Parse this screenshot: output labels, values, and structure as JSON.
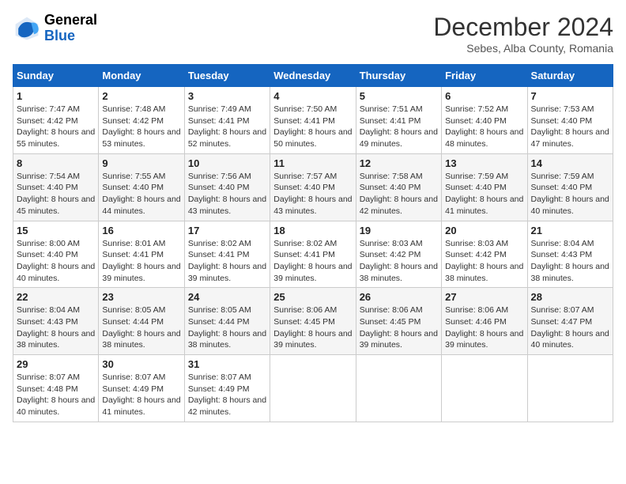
{
  "header": {
    "logo_general": "General",
    "logo_blue": "Blue",
    "title": "December 2024",
    "location": "Sebes, Alba County, Romania"
  },
  "calendar": {
    "days_of_week": [
      "Sunday",
      "Monday",
      "Tuesday",
      "Wednesday",
      "Thursday",
      "Friday",
      "Saturday"
    ],
    "weeks": [
      [
        null,
        null,
        null,
        null,
        null,
        null,
        null
      ]
    ],
    "cells": [
      {
        "day": null,
        "sunrise": null,
        "sunset": null,
        "daylight": null
      },
      {
        "day": 1,
        "sunrise": "7:47 AM",
        "sunset": "4:42 PM",
        "daylight": "8 hours and 55 minutes."
      },
      {
        "day": 2,
        "sunrise": "7:48 AM",
        "sunset": "4:42 PM",
        "daylight": "8 hours and 53 minutes."
      },
      {
        "day": 3,
        "sunrise": "7:49 AM",
        "sunset": "4:41 PM",
        "daylight": "8 hours and 52 minutes."
      },
      {
        "day": 4,
        "sunrise": "7:50 AM",
        "sunset": "4:41 PM",
        "daylight": "8 hours and 50 minutes."
      },
      {
        "day": 5,
        "sunrise": "7:51 AM",
        "sunset": "4:41 PM",
        "daylight": "8 hours and 49 minutes."
      },
      {
        "day": 6,
        "sunrise": "7:52 AM",
        "sunset": "4:40 PM",
        "daylight": "8 hours and 48 minutes."
      },
      {
        "day": 7,
        "sunrise": "7:53 AM",
        "sunset": "4:40 PM",
        "daylight": "8 hours and 47 minutes."
      },
      {
        "day": 8,
        "sunrise": "7:54 AM",
        "sunset": "4:40 PM",
        "daylight": "8 hours and 45 minutes."
      },
      {
        "day": 9,
        "sunrise": "7:55 AM",
        "sunset": "4:40 PM",
        "daylight": "8 hours and 44 minutes."
      },
      {
        "day": 10,
        "sunrise": "7:56 AM",
        "sunset": "4:40 PM",
        "daylight": "8 hours and 43 minutes."
      },
      {
        "day": 11,
        "sunrise": "7:57 AM",
        "sunset": "4:40 PM",
        "daylight": "8 hours and 43 minutes."
      },
      {
        "day": 12,
        "sunrise": "7:58 AM",
        "sunset": "4:40 PM",
        "daylight": "8 hours and 42 minutes."
      },
      {
        "day": 13,
        "sunrise": "7:59 AM",
        "sunset": "4:40 PM",
        "daylight": "8 hours and 41 minutes."
      },
      {
        "day": 14,
        "sunrise": "7:59 AM",
        "sunset": "4:40 PM",
        "daylight": "8 hours and 40 minutes."
      },
      {
        "day": 15,
        "sunrise": "8:00 AM",
        "sunset": "4:40 PM",
        "daylight": "8 hours and 40 minutes."
      },
      {
        "day": 16,
        "sunrise": "8:01 AM",
        "sunset": "4:41 PM",
        "daylight": "8 hours and 39 minutes."
      },
      {
        "day": 17,
        "sunrise": "8:02 AM",
        "sunset": "4:41 PM",
        "daylight": "8 hours and 39 minutes."
      },
      {
        "day": 18,
        "sunrise": "8:02 AM",
        "sunset": "4:41 PM",
        "daylight": "8 hours and 39 minutes."
      },
      {
        "day": 19,
        "sunrise": "8:03 AM",
        "sunset": "4:42 PM",
        "daylight": "8 hours and 38 minutes."
      },
      {
        "day": 20,
        "sunrise": "8:03 AM",
        "sunset": "4:42 PM",
        "daylight": "8 hours and 38 minutes."
      },
      {
        "day": 21,
        "sunrise": "8:04 AM",
        "sunset": "4:43 PM",
        "daylight": "8 hours and 38 minutes."
      },
      {
        "day": 22,
        "sunrise": "8:04 AM",
        "sunset": "4:43 PM",
        "daylight": "8 hours and 38 minutes."
      },
      {
        "day": 23,
        "sunrise": "8:05 AM",
        "sunset": "4:44 PM",
        "daylight": "8 hours and 38 minutes."
      },
      {
        "day": 24,
        "sunrise": "8:05 AM",
        "sunset": "4:44 PM",
        "daylight": "8 hours and 38 minutes."
      },
      {
        "day": 25,
        "sunrise": "8:06 AM",
        "sunset": "4:45 PM",
        "daylight": "8 hours and 39 minutes."
      },
      {
        "day": 26,
        "sunrise": "8:06 AM",
        "sunset": "4:45 PM",
        "daylight": "8 hours and 39 minutes."
      },
      {
        "day": 27,
        "sunrise": "8:06 AM",
        "sunset": "4:46 PM",
        "daylight": "8 hours and 39 minutes."
      },
      {
        "day": 28,
        "sunrise": "8:07 AM",
        "sunset": "4:47 PM",
        "daylight": "8 hours and 40 minutes."
      },
      {
        "day": 29,
        "sunrise": "8:07 AM",
        "sunset": "4:48 PM",
        "daylight": "8 hours and 40 minutes."
      },
      {
        "day": 30,
        "sunrise": "8:07 AM",
        "sunset": "4:49 PM",
        "daylight": "8 hours and 41 minutes."
      },
      {
        "day": 31,
        "sunrise": "8:07 AM",
        "sunset": "4:49 PM",
        "daylight": "8 hours and 42 minutes."
      }
    ]
  }
}
